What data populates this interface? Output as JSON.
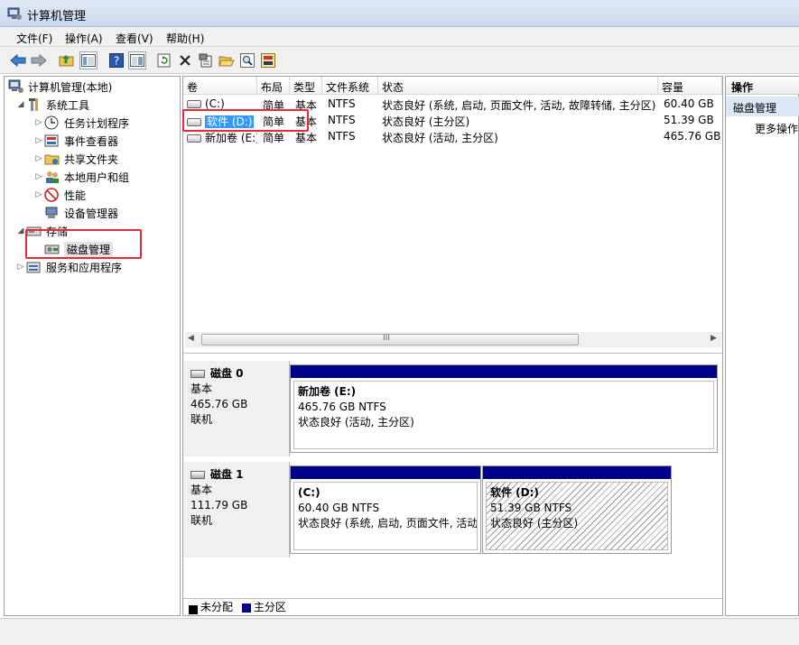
{
  "window": {
    "title": "计算机管理"
  },
  "menu": [
    "文件(F)",
    "操作(A)",
    "查看(V)",
    "帮助(H)"
  ],
  "tree": {
    "root": "计算机管理(本地)",
    "system_tools": "系统工具",
    "task_scheduler": "任务计划程序",
    "event_viewer": "事件查看器",
    "shared_folders": "共享文件夹",
    "local_users": "本地用户和组",
    "performance": "性能",
    "device_manager": "设备管理器",
    "storage": "存储",
    "disk_management": "磁盘管理",
    "services": "服务和应用程序"
  },
  "volume_table": {
    "headers": [
      "卷",
      "布局",
      "类型",
      "文件系统",
      "状态",
      "容量"
    ],
    "rows": [
      [
        "(C:)",
        "简单",
        "基本",
        "NTFS",
        "状态良好 (系统, 启动, 页面文件, 活动, 故障转储, 主分区)",
        "60.40 GB"
      ],
      [
        "软件 (D:)",
        "简单",
        "基本",
        "NTFS",
        "状态良好 (主分区)",
        "51.39 GB"
      ],
      [
        "新加卷 (E:)",
        "简单",
        "基本",
        "NTFS",
        "状态良好 (活动, 主分区)",
        "465.76 GB"
      ]
    ],
    "scroll_grip": "III"
  },
  "disks": [
    {
      "name": "磁盘 0",
      "type": "基本",
      "size": "465.76 GB",
      "state": "联机",
      "partitions": [
        {
          "label": "新加卷  (E:)",
          "size": "465.76 GB NTFS",
          "status": "状态良好 (活动, 主分区)"
        }
      ]
    },
    {
      "name": "磁盘 1",
      "type": "基本",
      "size": "111.79 GB",
      "state": "联机",
      "partitions": [
        {
          "label": "(C:)",
          "size": "60.40 GB NTFS",
          "status": "状态良好 (系统, 启动, 页面文件, 活动"
        },
        {
          "label": "软件  (D:)",
          "size": "51.39 GB NTFS",
          "status": "状态良好 (主分区)"
        }
      ]
    }
  ],
  "legend": {
    "unallocated": "未分配",
    "primary": "主分区"
  },
  "actions": {
    "header": "操作",
    "section": "磁盘管理",
    "more": "更多操作"
  },
  "colors": {
    "primary_partition": "#00008b",
    "unallocated": "#000000",
    "highlight": "#e8293a",
    "selection": "#3399ff"
  }
}
